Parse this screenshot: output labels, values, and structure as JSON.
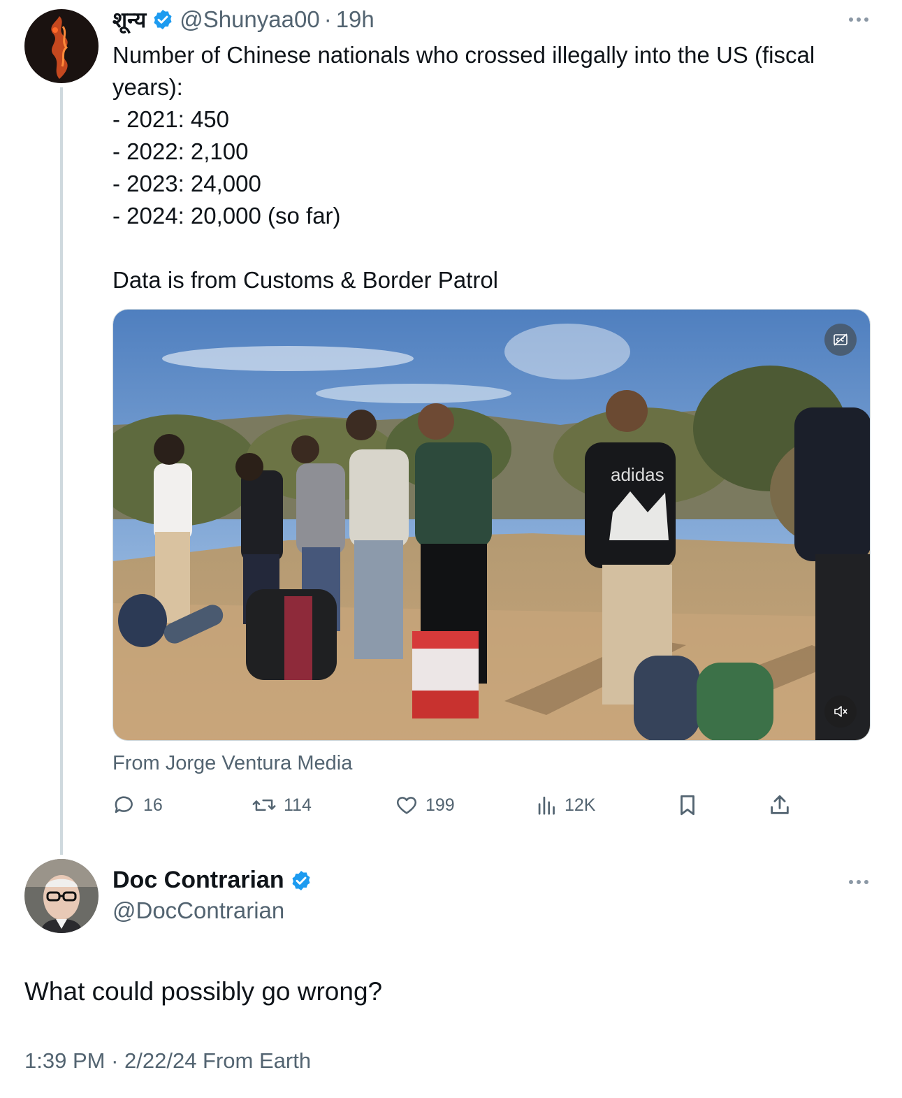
{
  "tweet": {
    "author_name": "शून्य",
    "handle": "@Shunyaa00",
    "separator": "·",
    "time": "19h",
    "lines": [
      "Number of Chinese nationals who crossed illegally into the US (fiscal",
      "years):",
      "- 2021: 450",
      "- 2022: 2,100",
      "- 2023: 24,000",
      "- 2024: 20,000 (so far)",
      "",
      "Data is from Customs & Border Patrol"
    ],
    "media_source": "From Jorge Ventura Media",
    "media_overlay_text": "adidas",
    "counts": {
      "replies": "16",
      "reposts": "114",
      "likes": "199",
      "views": "12K"
    }
  },
  "reply": {
    "author_name": "Doc Contrarian",
    "handle": "@DocContrarian",
    "text": "What could possibly go wrong?",
    "timestamp": "1:39 PM",
    "separator": "·",
    "date_origin": "2/22/24 From Earth"
  },
  "icons": {
    "verified": "verified-badge-icon",
    "more": "more-options-icon",
    "reply": "reply-icon",
    "repost": "repost-icon",
    "like": "heart-icon",
    "views": "views-icon",
    "bookmark": "bookmark-icon",
    "share": "share-icon",
    "captions": "captions-off-icon",
    "mute": "muted-speaker-icon"
  },
  "colors": {
    "verified_blue": "#1d9bf0",
    "secondary_text": "#536471",
    "thread_line": "#cfd9de"
  }
}
